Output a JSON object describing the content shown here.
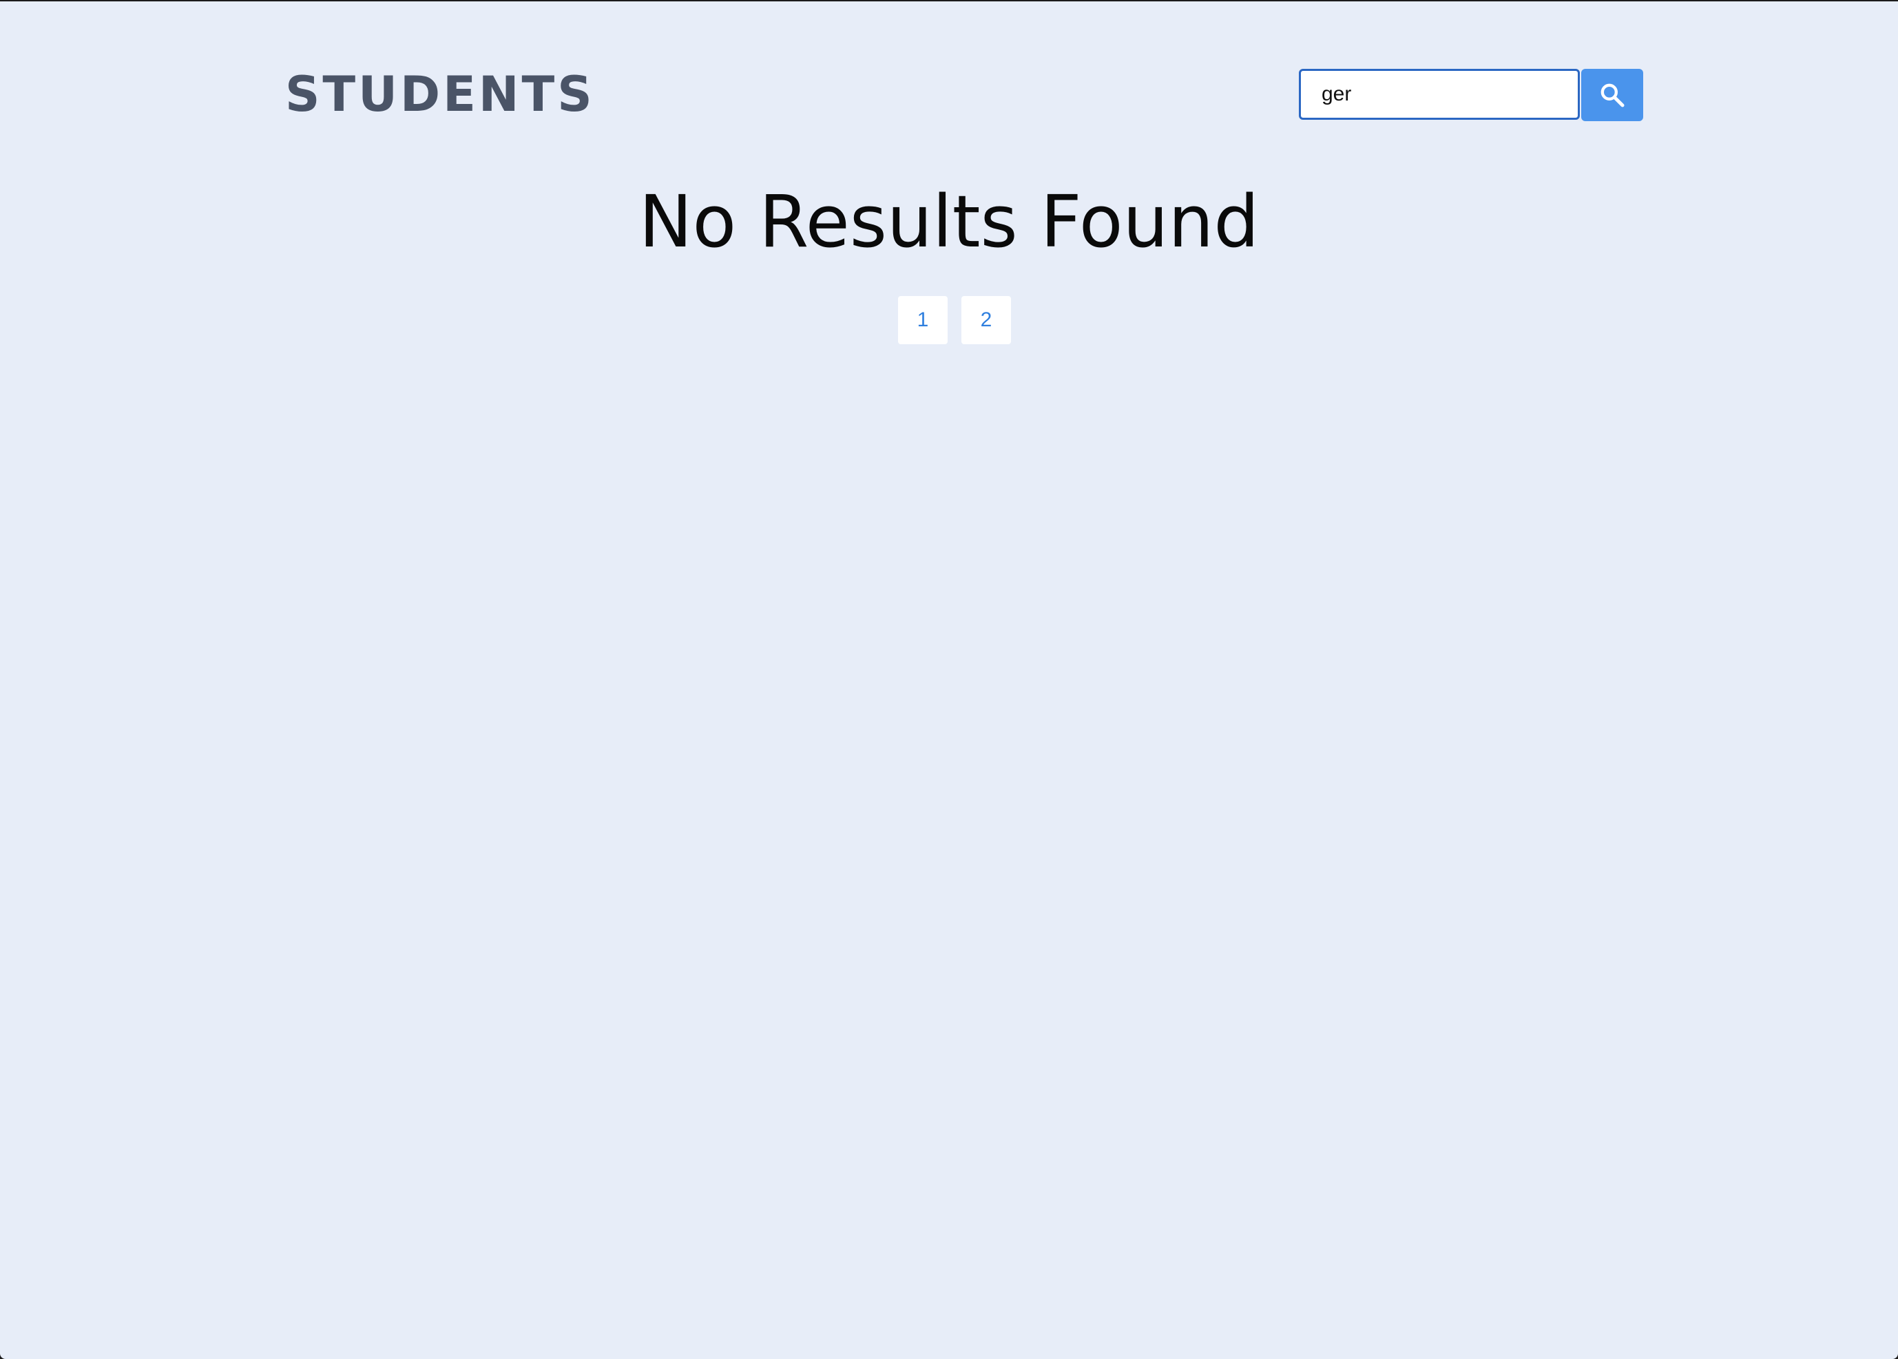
{
  "header": {
    "brand": "STUDENTS"
  },
  "search": {
    "value": "ger",
    "placeholder": "",
    "button_icon": "search-icon"
  },
  "results": {
    "message": "No Results Found"
  },
  "pagination": {
    "pages": [
      "1",
      "2"
    ]
  },
  "colors": {
    "background": "#e7edf8",
    "brand": "#4a5467",
    "accent": "#4a94ec",
    "link": "#2f7fde"
  }
}
